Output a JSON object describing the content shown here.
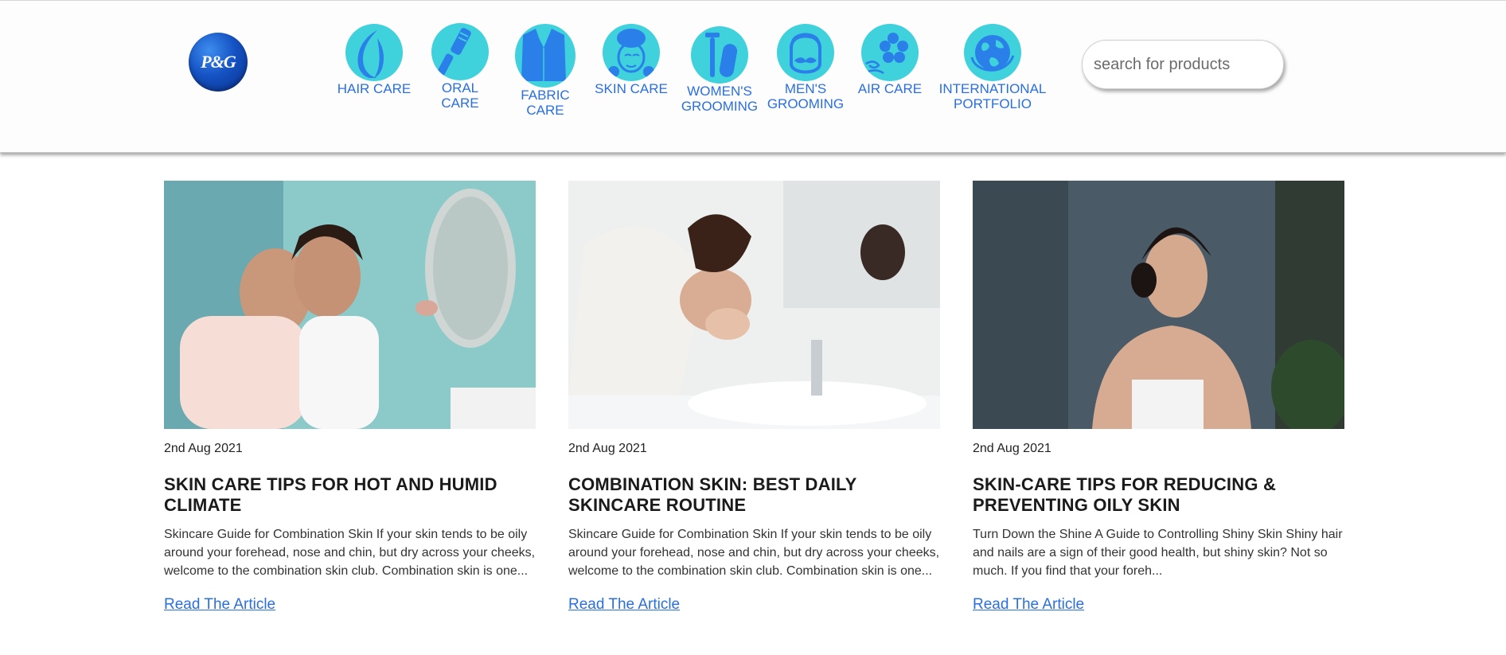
{
  "header": {
    "logo_text": "P&G",
    "categories": [
      {
        "label": "Hair Care",
        "icon": "hair-icon"
      },
      {
        "label": "Oral\nCare",
        "icon": "toothbrush-icon"
      },
      {
        "label": "Fabric\nCare",
        "icon": "shirt-icon"
      },
      {
        "label": "Skin Care",
        "icon": "face-cream-icon"
      },
      {
        "label": "Women's\nGrooming",
        "icon": "razor-pad-icon"
      },
      {
        "label": "Men's\nGrooming",
        "icon": "mustache-face-icon"
      },
      {
        "label": "Air Care",
        "icon": "flower-breeze-icon"
      },
      {
        "label": "International\nPortfolio",
        "icon": "globe-icon"
      }
    ],
    "search": {
      "placeholder": "search for products",
      "value": ""
    }
  },
  "articles": [
    {
      "date": "2nd Aug 2021",
      "title": "Skin Care Tips for Hot and Humid Climate",
      "excerpt": "Skincare Guide for Combination Skin If your skin tends to be oily around your forehead, nose and chin, but dry across your cheeks, welcome to the combination skin club. Combination skin is one...",
      "link": "Read The Article"
    },
    {
      "date": "2nd Aug 2021",
      "title": "Combination Skin: Best Daily Skincare Routine",
      "excerpt": "Skincare Guide for Combination Skin If your skin tends to be oily around your forehead, nose and chin, but dry across your cheeks, welcome to the combination skin club. Combination skin is one...",
      "link": "Read The Article"
    },
    {
      "date": "2nd Aug 2021",
      "title": "Skin-Care Tips for Reducing & Preventing Oily Skin",
      "excerpt": "Turn Down the Shine A Guide to Controlling Shiny Skin Shiny hair and nails are a sign of their good health, but shiny skin? Not so much. If you find that your foreh...",
      "link": "Read The Article"
    }
  ],
  "colors": {
    "accent": "#2a6fe0",
    "icon_bg": "#3fd1dc",
    "icon_fg": "#2a7fe8"
  }
}
